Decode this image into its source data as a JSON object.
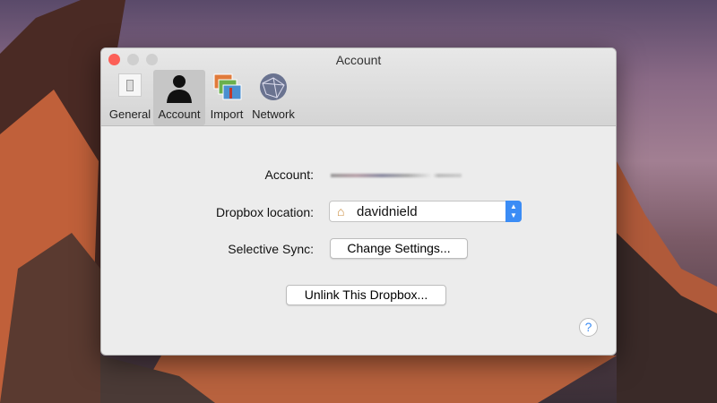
{
  "window": {
    "title": "Account"
  },
  "toolbar": [
    {
      "label": "General",
      "icon": "switch-icon"
    },
    {
      "label": "Account",
      "icon": "person-icon",
      "selected": true
    },
    {
      "label": "Import",
      "icon": "photos-icon"
    },
    {
      "label": "Network",
      "icon": "globe-icon"
    }
  ],
  "form": {
    "account_label": "Account:",
    "location_label": "Dropbox location:",
    "location_value": "davidnield",
    "sync_label": "Selective Sync:",
    "change_settings": "Change Settings...",
    "unlink": "Unlink This Dropbox...",
    "help": "?"
  },
  "colors": {
    "accent": "#3b8cf5",
    "close": "#fc5f57"
  }
}
